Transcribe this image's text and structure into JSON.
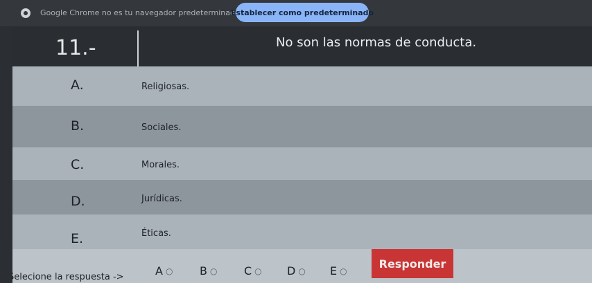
{
  "infobar": {
    "message": "Google Chrome no es tu navegador predeterminado",
    "button_label": "Establecer como predeterminado"
  },
  "question": {
    "number": "11.-",
    "text": "No son las normas de conducta."
  },
  "options": [
    {
      "letter": "A.",
      "text": "Religiosas."
    },
    {
      "letter": "B.",
      "text": "Sociales."
    },
    {
      "letter": "C.",
      "text": "Morales."
    },
    {
      "letter": "D.",
      "text": "Jurídicas."
    },
    {
      "letter": "E.",
      "text": "Éticas."
    }
  ],
  "answer": {
    "prompt": "Selecione la respuesta ->",
    "choices": [
      "A",
      "B",
      "C",
      "D",
      "E"
    ],
    "submit_label": "Responder"
  }
}
